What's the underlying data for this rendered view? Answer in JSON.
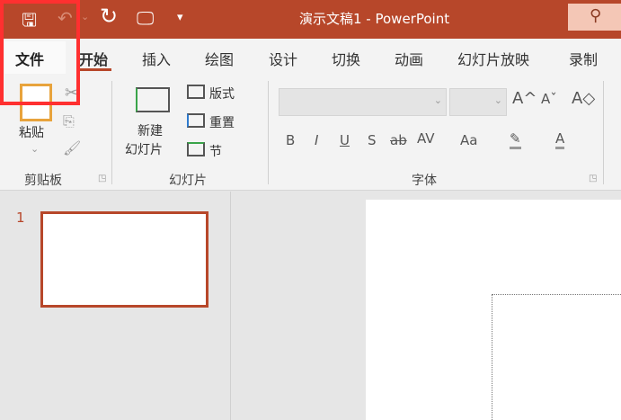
{
  "titlebar": {
    "title": "演示文稿1  -  PowerPoint",
    "accent": "#b7472a"
  },
  "quick_access": {
    "save": "🖫",
    "undo": "↶",
    "undo_dd": "⌄",
    "redo": "↻",
    "present": "🖵",
    "customize": "▾"
  },
  "search": {
    "icon": "⚲"
  },
  "tabs": [
    "文件",
    "开始",
    "插入",
    "绘图",
    "设计",
    "切换",
    "动画",
    "幻灯片放映",
    "录制"
  ],
  "clipboard": {
    "paste": "粘贴",
    "paste_dd": "⌄",
    "group": "剪贴板"
  },
  "slides": {
    "new_slide_1": "新建",
    "new_slide_2": "幻灯片",
    "layout": "版式",
    "reset": "重置",
    "section": "节",
    "group": "幻灯片"
  },
  "font": {
    "group": "字体",
    "grow": "A^",
    "shrink": "Aˇ",
    "clear": "A◇",
    "bold": "B",
    "italic": "I",
    "underline": "U",
    "shadow": "S",
    "strike": "ab",
    "spacing": "AV",
    "case": "Aa",
    "highlight": "✎",
    "color": "A"
  },
  "thumbnails": {
    "number": "1"
  }
}
